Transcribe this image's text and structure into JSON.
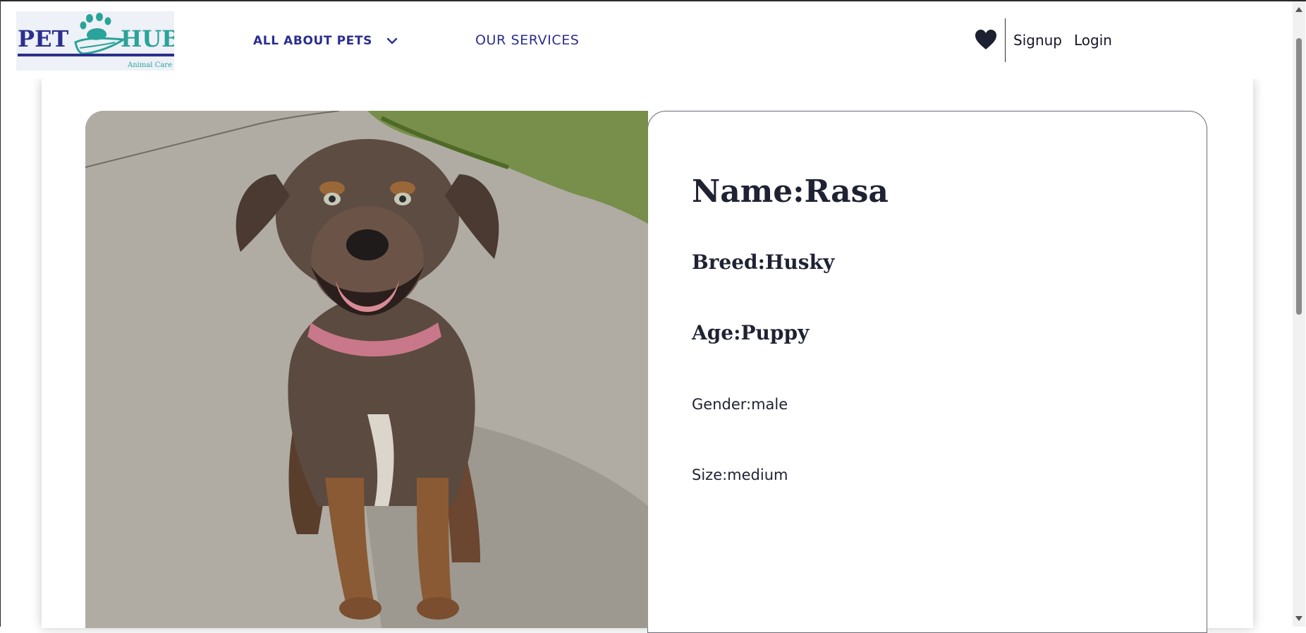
{
  "brand": {
    "name_left": "PET",
    "name_right": "HUB",
    "tagline": "Animal Care"
  },
  "nav": {
    "all_about_pets": "ALL ABOUT PETS",
    "our_services": "OUR SERVICES"
  },
  "auth": {
    "signup": "Signup",
    "login": "Login"
  },
  "icons": {
    "favorites": "heart-icon",
    "dropdown": "chevron-down-icon",
    "logo": "paw-hand-icon"
  },
  "pet": {
    "name_line": "Name:Rasa",
    "breed_line": "Breed:Husky",
    "age_line": "Age:Puppy",
    "gender_line": "Gender:male",
    "size_line": "Size:medium",
    "photo_alt": "Photo of Rasa"
  },
  "colors": {
    "brand_teal": "#2aa39a",
    "brand_navy": "#2b2f8f",
    "text_dark": "#1f2233"
  }
}
